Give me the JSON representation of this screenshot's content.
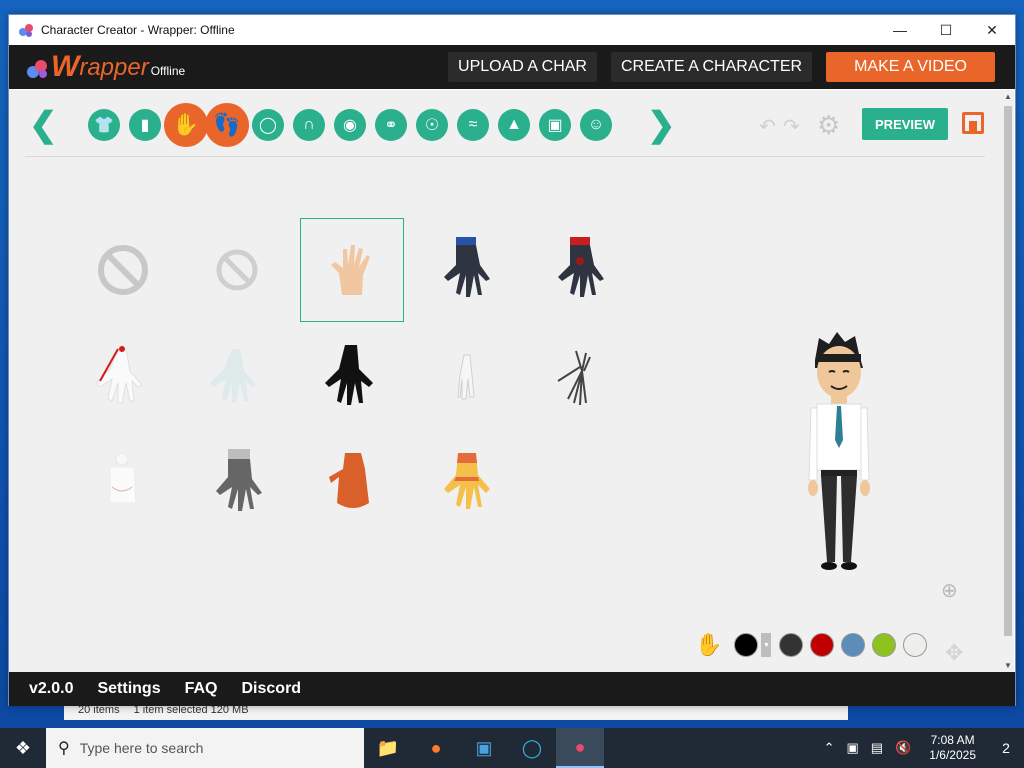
{
  "window": {
    "title": "Character Creator - Wrapper: Offline"
  },
  "header": {
    "logo_w": "W",
    "logo_rest": "rapper",
    "logo_suffix": "Offline",
    "buttons": [
      "UPLOAD A CHAR",
      "CREATE A CHARACTER",
      "MAKE A VIDEO"
    ]
  },
  "toolbar": {
    "preview_label": "PREVIEW",
    "categories": [
      "shirt",
      "pants",
      "hands",
      "shoes",
      "face",
      "hair",
      "mouth",
      "ear",
      "eye",
      "eyebrow",
      "nose",
      "glasses",
      "head"
    ],
    "active_category": "hands"
  },
  "colors": {
    "accent": "#2bb08e",
    "brand": "#e9652a",
    "swatches": [
      "#000000",
      "#333333",
      "#c00000",
      "#5b8db8",
      "#8dc21f",
      "#eeeeea"
    ]
  },
  "footer": {
    "items": [
      "v2.0.0",
      "Settings",
      "FAQ",
      "Discord"
    ]
  },
  "explorer": {
    "items_count": "20 items",
    "selected": "1 item selected  120 MB"
  },
  "taskbar": {
    "search_placeholder": "Type here to search",
    "time": "7:08 AM",
    "date": "1/6/2025",
    "notifications": "2"
  }
}
